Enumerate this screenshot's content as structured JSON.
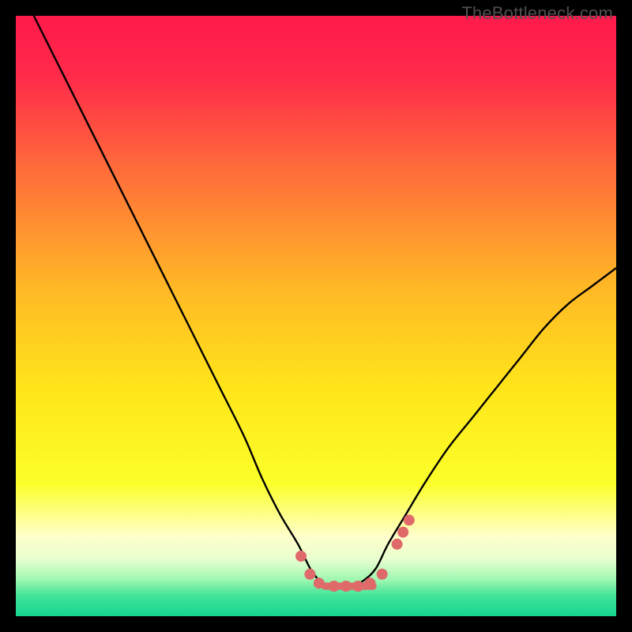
{
  "watermark": "TheBottleneck.com",
  "chart_data": {
    "type": "line",
    "title": "",
    "xlabel": "",
    "ylabel": "",
    "xlim": [
      0,
      100
    ],
    "ylim": [
      0,
      100
    ],
    "background_gradient_stops": [
      {
        "pos": 0.0,
        "color": "#ff1a4b"
      },
      {
        "pos": 0.1,
        "color": "#ff2a4a"
      },
      {
        "pos": 0.25,
        "color": "#ff6a3b"
      },
      {
        "pos": 0.45,
        "color": "#ffb726"
      },
      {
        "pos": 0.62,
        "color": "#ffe51a"
      },
      {
        "pos": 0.78,
        "color": "#fbff2a"
      },
      {
        "pos": 0.865,
        "color": "#ffffc8"
      },
      {
        "pos": 0.905,
        "color": "#e9ffd0"
      },
      {
        "pos": 0.94,
        "color": "#9cf7af"
      },
      {
        "pos": 0.965,
        "color": "#44e39a"
      },
      {
        "pos": 1.0,
        "color": "#17d68e"
      }
    ],
    "series": [
      {
        "name": "bottleneck-curve",
        "color": "#000000",
        "x": [
          3,
          6,
          10,
          14,
          18,
          22,
          26,
          30,
          34,
          38,
          41,
          44,
          47,
          49,
          50.5,
          52,
          54,
          56,
          58,
          60,
          62,
          65,
          68,
          72,
          76,
          80,
          84,
          88,
          92,
          96,
          100
        ],
        "y": [
          100,
          94,
          86,
          78,
          70,
          62,
          54,
          46,
          38,
          30,
          23,
          17,
          12,
          8,
          6,
          5,
          5,
          5,
          6,
          8,
          12,
          17,
          22,
          28,
          33,
          38,
          43,
          48,
          52,
          55,
          58
        ]
      }
    ],
    "markers": {
      "name": "highlight-dots",
      "color": "#e06a6a",
      "points": [
        {
          "x": 47.5,
          "y": 10
        },
        {
          "x": 49.0,
          "y": 7
        },
        {
          "x": 50.5,
          "y": 5.5
        },
        {
          "x": 53.0,
          "y": 5
        },
        {
          "x": 55.0,
          "y": 5
        },
        {
          "x": 57.0,
          "y": 5
        },
        {
          "x": 59.0,
          "y": 5.5
        },
        {
          "x": 61.0,
          "y": 7
        },
        {
          "x": 63.5,
          "y": 12
        },
        {
          "x": 64.5,
          "y": 14
        },
        {
          "x": 65.5,
          "y": 16
        }
      ],
      "bar": {
        "x0": 51.5,
        "x1": 59.5,
        "y": 5,
        "thickness": 2.2
      }
    }
  }
}
